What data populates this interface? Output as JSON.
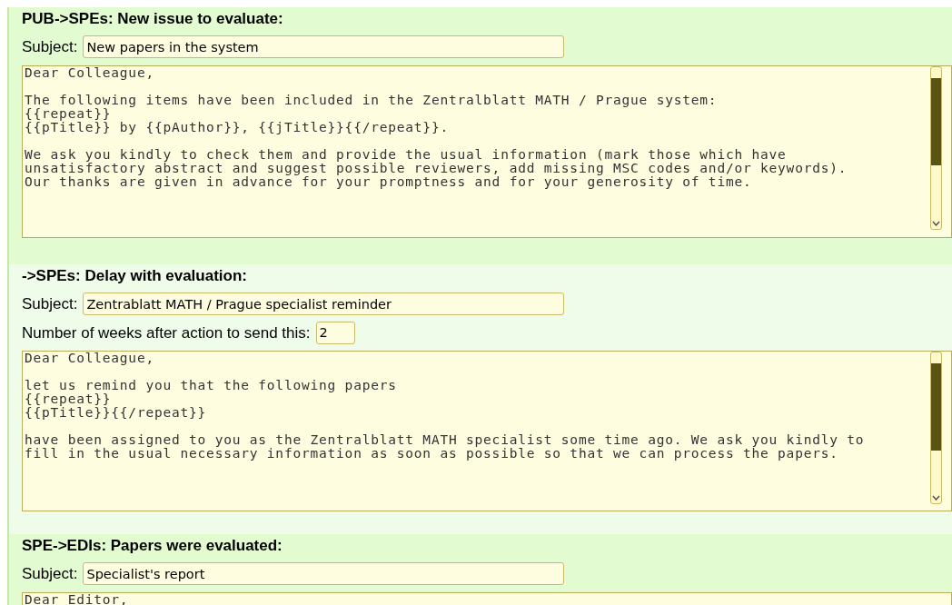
{
  "sections": [
    {
      "heading": "PUB->SPEs: New issue to evaluate:",
      "subject_label": "Subject:",
      "subject": "New papers in the system",
      "body": [
        [
          "Dear Colleague,"
        ],
        [
          "The following items have been included in the Zentralblatt MATH / Prague system:",
          "{{repeat}}",
          "{{pTitle}} by {{pAuthor}}, {{jTitle}}{{/repeat}}."
        ],
        [
          "We ask you kindly to check them and provide the usual information (mark those which have",
          "unsatisfactory abstract and suggest possible reviewers, add missing MSC codes and/or keywords).",
          "Our thanks are given in advance for your promptness and for your generosity of time."
        ]
      ]
    },
    {
      "heading": "->SPEs: Delay with evaluation:",
      "subject_label": "Subject:",
      "subject": "Zentrablatt MATH / Prague specialist reminder",
      "weeks_label": "Number of weeks after action to send this:",
      "weeks": "2",
      "body": [
        [
          "Dear Colleague,"
        ],
        [
          "let us remind you that the following papers",
          "{{repeat}}",
          "{{pTitle}}{{/repeat}}"
        ],
        [
          "have been assigned to you as the Zentralblatt MATH specialist some time ago. We ask you kindly to",
          "fill in the usual necessary information as soon as possible so that we can process the papers."
        ]
      ]
    },
    {
      "heading": "SPE->EDIs: Papers were evaluated:",
      "subject_label": "Subject:",
      "subject": "Specialist's report",
      "body": [
        [
          "Dear Editor,"
        ]
      ]
    }
  ]
}
